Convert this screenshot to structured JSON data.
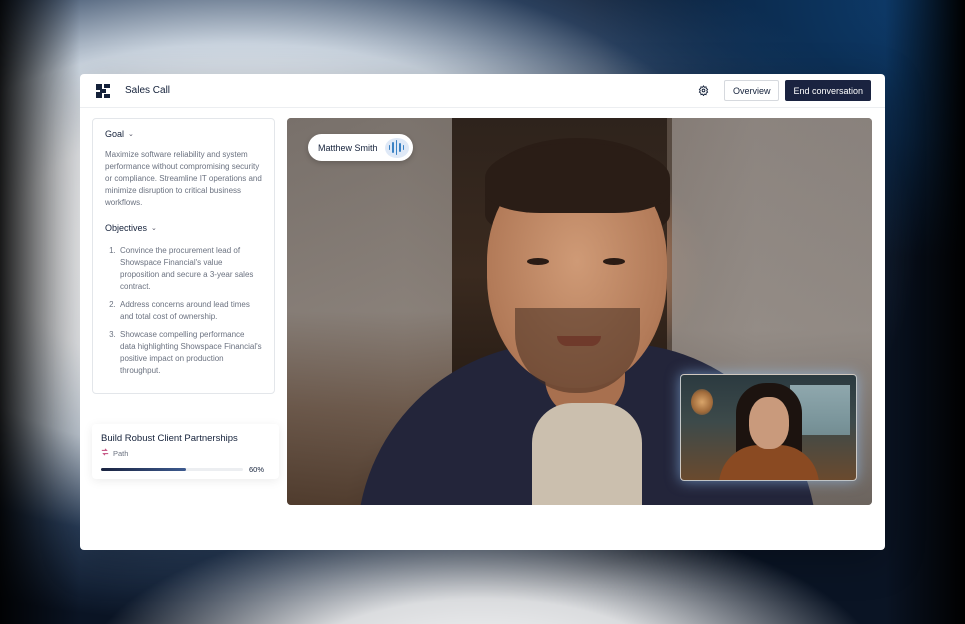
{
  "app": {
    "title": "Sales Call"
  },
  "toolbar": {
    "settings_icon": "gear-icon",
    "overview_label": "Overview",
    "end_label": "End conversation"
  },
  "goal": {
    "heading": "Goal",
    "text": "Maximize software reliability and system performance without compromising security or compliance. Streamline IT operations and minimize disruption to critical business workflows."
  },
  "objectives": {
    "heading": "Objectives",
    "items": [
      "Convince the procurement lead of Showspace Financial's value proposition and secure a 3-year sales contract.",
      "Address concerns around lead times and total cost of ownership.",
      "Showcase compelling performance data highlighting Showspace Financial's positive impact on production throughput."
    ]
  },
  "path": {
    "title": "Build Robust Client Partnerships",
    "subtitle": "Path",
    "progress": 0.6,
    "progress_label": "60%"
  },
  "video": {
    "speaker_name": "Matthew Smith",
    "speaking_icon": "audio-wave-icon"
  },
  "colors": {
    "brand_dark": "#1a2340",
    "audio_accent": "#3b82c4"
  }
}
